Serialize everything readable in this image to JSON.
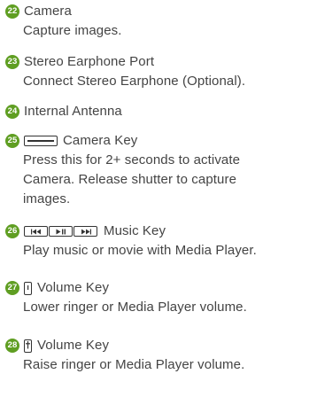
{
  "items": [
    {
      "num": "22",
      "title": "Camera",
      "desc": [
        "Capture images."
      ]
    },
    {
      "num": "23",
      "title": "Stereo Earphone Port",
      "desc": [
        "Connect Stereo Earphone (Optional)."
      ]
    },
    {
      "num": "24",
      "title": "Internal Antenna",
      "desc": []
    },
    {
      "num": "25",
      "icon": "camera-key-icon",
      "title": "Camera Key",
      "desc": [
        "Press this for 2+ seconds to activate",
        "Camera. Release shutter to capture",
        "images."
      ]
    },
    {
      "num": "26",
      "icon": "music-key-icon",
      "title": "Music Key",
      "desc": [
        "Play music or movie with Media Player."
      ]
    },
    {
      "num": "27",
      "icon": "volume-down-key-icon",
      "title": "Volume Key",
      "desc": [
        "Lower ringer or Media Player volume."
      ]
    },
    {
      "num": "28",
      "icon": "volume-up-key-icon",
      "title": "Volume Key",
      "desc": [
        "Raise ringer or Media Player volume."
      ]
    }
  ],
  "colors": {
    "badge": "#5f9e22",
    "text": "#444444"
  }
}
